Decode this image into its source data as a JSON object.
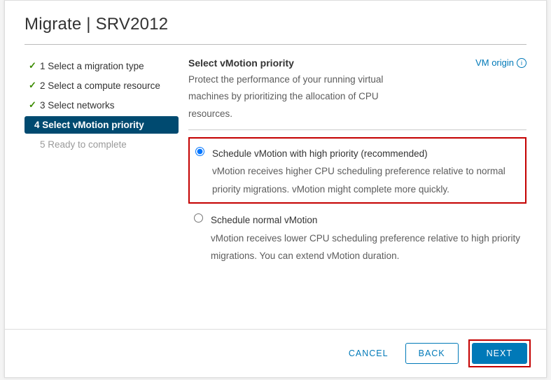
{
  "header": {
    "title": "Migrate | SRV2012"
  },
  "sidebar": {
    "steps": [
      {
        "num": "1",
        "label": "1 Select a migration type"
      },
      {
        "num": "2",
        "label": "2 Select a compute resource"
      },
      {
        "num": "3",
        "label": "3 Select networks"
      },
      {
        "num": "4",
        "label": "4 Select vMotion priority"
      },
      {
        "num": "5",
        "label": "5 Ready to complete"
      }
    ]
  },
  "main": {
    "section_title": "Select vMotion priority",
    "vm_origin": "VM origin",
    "desc": "Protect the performance of your running virtual machines by prioritizing the allocation of CPU resources."
  },
  "options": {
    "opt1_title": "Schedule vMotion with high priority (recommended)",
    "opt1_desc": "vMotion receives higher CPU scheduling preference relative to normal priority migrations. vMotion might complete more quickly.",
    "opt2_title": "Schedule normal vMotion",
    "opt2_desc": "vMotion receives lower CPU scheduling preference relative to high priority migrations. You can extend vMotion duration."
  },
  "footer": {
    "cancel": "CANCEL",
    "back": "BACK",
    "next": "NEXT"
  }
}
